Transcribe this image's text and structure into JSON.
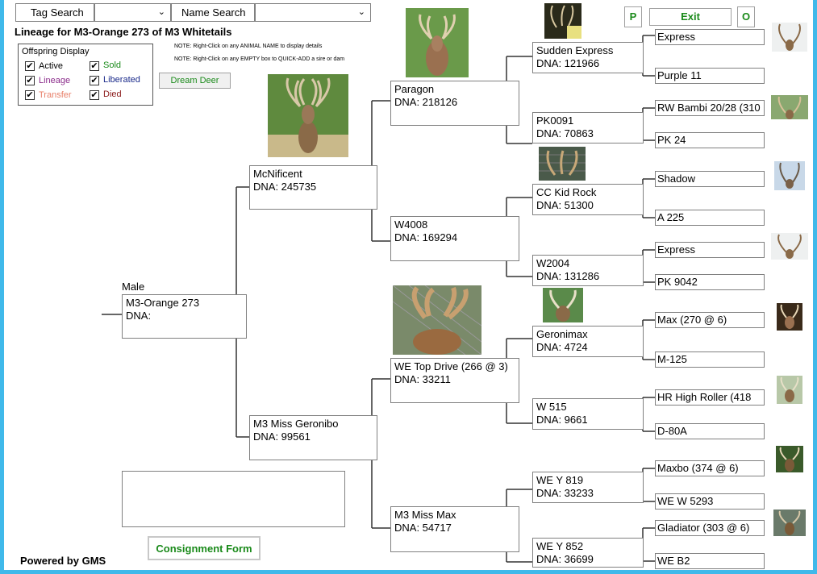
{
  "search": {
    "tag_label": "Tag Search",
    "name_label": "Name Search"
  },
  "title": "Lineage for M3-Orange 273 of M3 Whitetails",
  "notes": {
    "note1": "NOTE: Right-Click on any ANIMAL NAME to display details",
    "note2": "NOTE: Right-Click on any EMPTY box to QUICK-ADD a sire or dam"
  },
  "offspring": {
    "title": "Offspring Display",
    "active": "Active",
    "sold": "Sold",
    "lineage": "Lineage",
    "liberated": "Liberated",
    "transfer": "Transfer",
    "died": "Died"
  },
  "colors": {
    "active": "#000000",
    "sold": "#1a8a1a",
    "lineage": "#8b2c8b",
    "liberated": "#1a2a8a",
    "transfer": "#e8806a",
    "died": "#8b1a1a",
    "border": "#40b9ea",
    "button_text": "#1a8a1a"
  },
  "buttons": {
    "dream_deer": "Dream Deer",
    "p": "P",
    "exit": "Exit",
    "o": "O",
    "consignment": "Consignment Form"
  },
  "subject": {
    "sex": "Male",
    "name": "M3-Orange 273",
    "dna": "DNA:"
  },
  "gen1": {
    "sire": {
      "name": "McNificent",
      "dna": "DNA: 245735"
    },
    "dam": {
      "name": "M3 Miss Geronibo",
      "dna": "DNA: 99561"
    }
  },
  "gen2": {
    "a": {
      "name": "Paragon",
      "dna": "DNA: 218126"
    },
    "b": {
      "name": "W4008",
      "dna": "DNA: 169294"
    },
    "c": {
      "name": "WE Top Drive (266 @ 3)",
      "dna": "DNA: 33211"
    },
    "d": {
      "name": "M3 Miss Max",
      "dna": "DNA: 54717"
    }
  },
  "gen3": {
    "a": {
      "name": "Sudden Express",
      "dna": "DNA: 121966"
    },
    "b": {
      "name": "PK0091",
      "dna": "DNA: 70863"
    },
    "c": {
      "name": "CC Kid Rock",
      "dna": "DNA: 51300"
    },
    "d": {
      "name": "W2004",
      "dna": "DNA: 131286"
    },
    "e": {
      "name": "Geronimax",
      "dna": "DNA: 4724"
    },
    "f": {
      "name": "W 515",
      "dna": "DNA: 9661"
    },
    "g": {
      "name": "WE Y 819",
      "dna": "DNA: 33233"
    },
    "h": {
      "name": "WE Y 852",
      "dna": "DNA: 36699"
    }
  },
  "gen4": [
    "Express",
    "Purple 11",
    "RW Bambi 20/28 (310",
    "PK 24",
    "Shadow",
    "A 225",
    "Express",
    "PK 9042",
    "Max (270 @ 6)",
    "M-125",
    "HR High Roller (418",
    "D-80A",
    "Maxbo (374 @ 6)",
    "WE W 5293",
    "Gladiator (303 @ 6)",
    "WE B2"
  ],
  "footer": {
    "powered": "Powered by GMS"
  }
}
